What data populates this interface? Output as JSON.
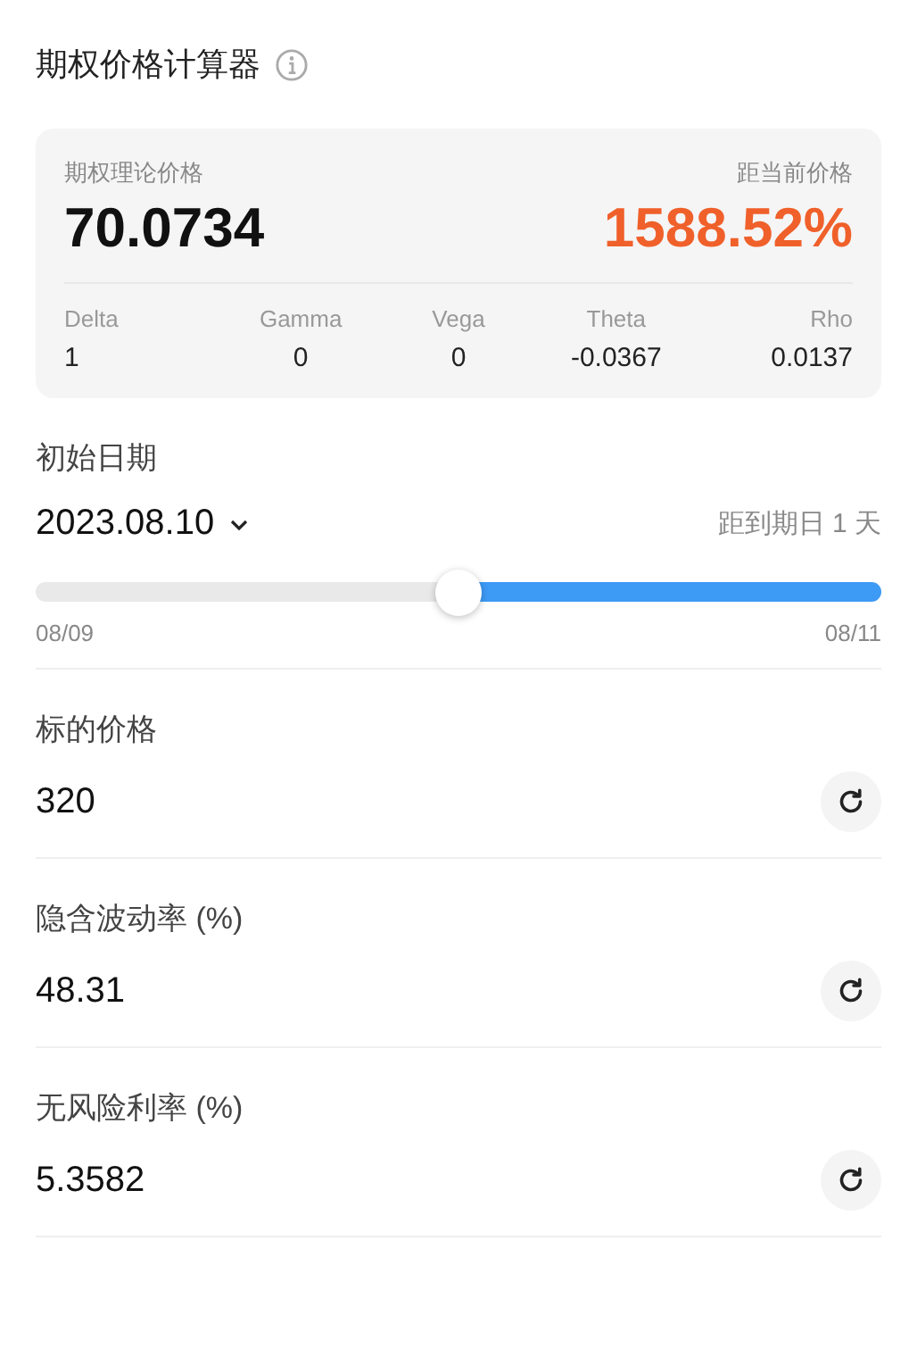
{
  "title": "期权价格计算器",
  "summary": {
    "price_label": "期权理论价格",
    "price": "70.0734",
    "change_label": "距当前价格",
    "change": "1588.52%",
    "greeks": [
      {
        "name": "Delta",
        "value": "1"
      },
      {
        "name": "Gamma",
        "value": "0"
      },
      {
        "name": "Vega",
        "value": "0"
      },
      {
        "name": "Theta",
        "value": "-0.0367"
      },
      {
        "name": "Rho",
        "value": "0.0137"
      }
    ]
  },
  "start_date": {
    "label": "初始日期",
    "value": "2023.08.10",
    "remaining": "距到期日 1 天",
    "level": 0.5,
    "min_label": "08/09",
    "max_label": "08/11"
  },
  "fields": [
    {
      "label": "标的价格",
      "value": "320"
    },
    {
      "label": "隐含波动率 (%)",
      "value": "48.31"
    },
    {
      "label": "无风险利率 (%)",
      "value": "5.3582"
    }
  ]
}
